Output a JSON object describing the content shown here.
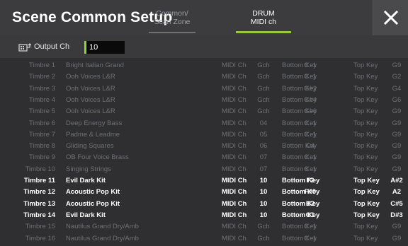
{
  "header": {
    "title": "Scene Common Setup",
    "tabs": [
      {
        "label": "Common/\nScan Zone",
        "active": false
      },
      {
        "label": "DRUM\nMIDI ch",
        "active": true
      }
    ],
    "close_icon": "close-x-icon"
  },
  "output": {
    "icon": "output-jack-icon",
    "label": "Output Ch",
    "value": "10"
  },
  "colors": {
    "accent": "#9ac63c",
    "disabled_text": "#6d7076",
    "enabled_text": "#ffffff"
  },
  "rows": [
    {
      "timbre": "Timbre 1",
      "program": "Bright Italian Grand",
      "midi_label": "MIDI Ch",
      "midi_value": "Gch",
      "bottom_label": "Bottom Key",
      "bottom_value": "C -1",
      "top_label": "Top Key",
      "top_value": "G9",
      "enabled": false
    },
    {
      "timbre": "Timbre 2",
      "program": "Ooh Voices L&R",
      "midi_label": "MIDI Ch",
      "midi_value": "Gch",
      "bottom_label": "Bottom Key",
      "bottom_value": "C -1",
      "top_label": "Top Key",
      "top_value": "G2",
      "enabled": false
    },
    {
      "timbre": "Timbre 3",
      "program": "Ooh Voices L&R",
      "midi_label": "MIDI Ch",
      "midi_value": "Gch",
      "bottom_label": "Bottom Key",
      "bottom_value": "G#2",
      "top_label": "Top Key",
      "top_value": "G4",
      "enabled": false
    },
    {
      "timbre": "Timbre 4",
      "program": "Ooh Voices L&R",
      "midi_label": "MIDI Ch",
      "midi_value": "Gch",
      "bottom_label": "Bottom Key",
      "bottom_value": "G#4",
      "top_label": "Top Key",
      "top_value": "G6",
      "enabled": false
    },
    {
      "timbre": "Timbre 5",
      "program": "Ooh Voices L&R",
      "midi_label": "MIDI Ch",
      "midi_value": "Gch",
      "bottom_label": "Bottom Key",
      "bottom_value": "G#6",
      "top_label": "Top Key",
      "top_value": "G9",
      "enabled": false
    },
    {
      "timbre": "Timbre 6",
      "program": "Deep Energy Bass",
      "midi_label": "MIDI Ch",
      "midi_value": "04",
      "bottom_label": "Bottom Key",
      "bottom_value": "C -1",
      "top_label": "Top Key",
      "top_value": "G9",
      "enabled": false
    },
    {
      "timbre": "Timbre 7",
      "program": "Padme & Leadme",
      "midi_label": "MIDI Ch",
      "midi_value": "05",
      "bottom_label": "Bottom Key",
      "bottom_value": "C -1",
      "top_label": "Top Key",
      "top_value": "G9",
      "enabled": false
    },
    {
      "timbre": "Timbre 8",
      "program": "Gliding Squares",
      "midi_label": "MIDI Ch",
      "midi_value": "06",
      "bottom_label": "Bottom Key",
      "bottom_value": "C4",
      "top_label": "Top Key",
      "top_value": "G9",
      "enabled": false
    },
    {
      "timbre": "Timbre 9",
      "program": "OB Four Voice Brass",
      "midi_label": "MIDI Ch",
      "midi_value": "07",
      "bottom_label": "Bottom Key",
      "bottom_value": "C -1",
      "top_label": "Top Key",
      "top_value": "G9",
      "enabled": false
    },
    {
      "timbre": "Timbre 10",
      "program": "Singing Strings",
      "midi_label": "MIDI Ch",
      "midi_value": "07",
      "bottom_label": "Bottom Key",
      "bottom_value": "C -1",
      "top_label": "Top Key",
      "top_value": "G9",
      "enabled": false
    },
    {
      "timbre": "Timbre 11",
      "program": "Evil Dark Kit",
      "midi_label": "MIDI Ch",
      "midi_value": "10",
      "bottom_label": "Bottom Key",
      "bottom_value": "F2",
      "top_label": "Top Key",
      "top_value": "A#2",
      "enabled": true
    },
    {
      "timbre": "Timbre 12",
      "program": "Acoustic Pop Kit",
      "midi_label": "MIDI Ch",
      "midi_value": "10",
      "bottom_label": "Bottom Key",
      "bottom_value": "F#0",
      "top_label": "Top Key",
      "top_value": "A2",
      "enabled": true
    },
    {
      "timbre": "Timbre 13",
      "program": "Acoustic Pop Kit",
      "midi_label": "MIDI Ch",
      "midi_value": "10",
      "bottom_label": "Bottom Key",
      "bottom_value": "B2",
      "top_label": "Top Key",
      "top_value": "C#5",
      "enabled": true
    },
    {
      "timbre": "Timbre 14",
      "program": "Evil Dark Kit",
      "midi_label": "MIDI Ch",
      "midi_value": "10",
      "bottom_label": "Bottom Key",
      "bottom_value": "G1",
      "top_label": "Top Key",
      "top_value": "D#3",
      "enabled": true
    },
    {
      "timbre": "Timbre 15",
      "program": "Nautilus Grand Dry/Amb",
      "midi_label": "MIDI Ch",
      "midi_value": "Gch",
      "bottom_label": "Bottom Key",
      "bottom_value": "C -1",
      "top_label": "Top Key",
      "top_value": "G9",
      "enabled": false
    },
    {
      "timbre": "Timbre 16",
      "program": "Nautilus Grand Dry/Amb",
      "midi_label": "MIDI Ch",
      "midi_value": "Gch",
      "bottom_label": "Bottom Key",
      "bottom_value": "C -1",
      "top_label": "Top Key",
      "top_value": "G9",
      "enabled": false
    }
  ]
}
